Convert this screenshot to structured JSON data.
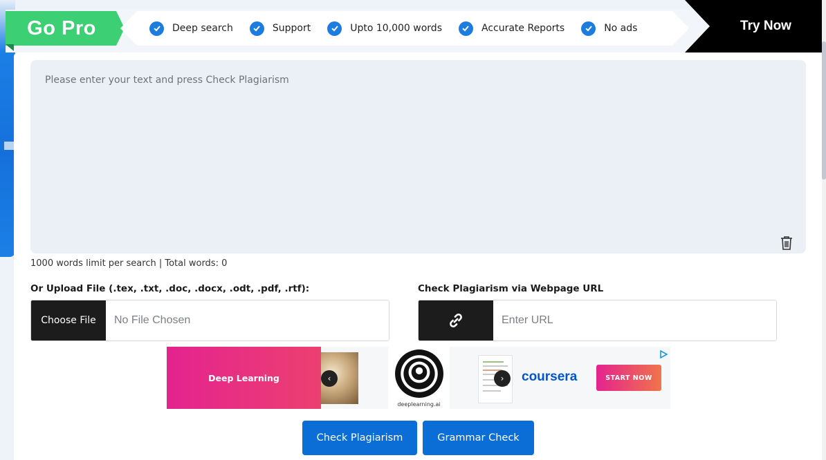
{
  "promo": {
    "gopro_label": "Go Pro",
    "features": [
      "Deep search",
      "Support",
      "Upto 10,000 words",
      "Accurate Reports",
      "No ads"
    ],
    "try_now_label": "Try Now",
    "colors": {
      "gopro": "#3ccf74",
      "check": "#1d7ce0",
      "try_now": "#000000"
    }
  },
  "editor": {
    "placeholder": "Please enter your text and press Check Plagiarism",
    "value": "",
    "word_info": "1000 words limit per search | Total words: 0",
    "clear_icon": "trash-icon"
  },
  "upload": {
    "label": "Or Upload File (.tex, .txt, .doc, .docx, .odt, .pdf, .rtf):",
    "button_label": "Choose File",
    "status": "No File Chosen"
  },
  "url_check": {
    "label": "Check Plagiarism via Webpage URL",
    "icon": "link-icon",
    "placeholder": "Enter URL",
    "value": ""
  },
  "ad": {
    "headline": "Deep Learning",
    "logo_caption": "deeplearning.ai",
    "brand": "coursera",
    "cta": "START NOW"
  },
  "actions": {
    "check_plagiarism": "Check Plagiarism",
    "grammar_check": "Grammar Check",
    "accent_color": "#0a6ed6"
  }
}
